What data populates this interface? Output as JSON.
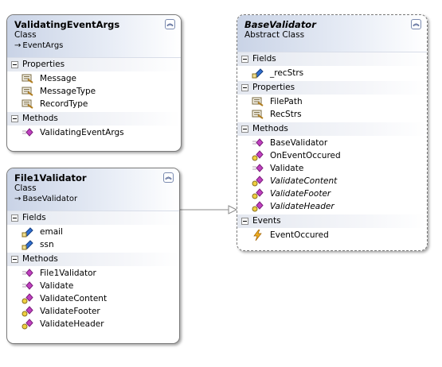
{
  "classes": {
    "validating_event_args": {
      "name": "ValidatingEventArgs",
      "kind": "Class",
      "base": "EventArgs",
      "sections": {
        "properties": {
          "label": "Properties",
          "items": [
            "Message",
            "MessageType",
            "RecordType"
          ]
        },
        "methods": {
          "label": "Methods",
          "items": [
            "ValidatingEventArgs"
          ]
        }
      }
    },
    "base_validator": {
      "name": "BaseValidator",
      "kind": "Abstract Class",
      "sections": {
        "fields": {
          "label": "Fields",
          "items": [
            "_recStrs"
          ]
        },
        "properties": {
          "label": "Properties",
          "items": [
            "FilePath",
            "RecStrs"
          ]
        },
        "methods": {
          "label": "Methods",
          "items": [
            "BaseValidator",
            "OnEventOccured",
            "Validate",
            "ValidateContent",
            "ValidateFooter",
            "ValidateHeader"
          ]
        },
        "events": {
          "label": "Events",
          "items": [
            "EventOccured"
          ]
        }
      }
    },
    "file1_validator": {
      "name": "File1Validator",
      "kind": "Class",
      "base": "BaseValidator",
      "sections": {
        "fields": {
          "label": "Fields",
          "items": [
            "email",
            "ssn"
          ]
        },
        "methods": {
          "label": "Methods",
          "items": [
            "File1Validator",
            "Validate",
            "ValidateContent",
            "ValidateFooter",
            "ValidateHeader"
          ]
        }
      }
    }
  },
  "icons": {
    "collapse": "double-chevron-up-icon",
    "base_arrow": "inheritance-arrow-icon",
    "property": "property-icon",
    "method": "method-icon",
    "protected_method": "protected-method-icon",
    "field": "private-field-icon",
    "event": "event-icon"
  },
  "colors": {
    "header_gradient": "#c9d3e6",
    "border": "#7a7a7a",
    "connector": "#8a8a8a",
    "method_icon": "#c040c0",
    "field_icon": "#2f6fd0",
    "event_icon": "#e0a000"
  }
}
